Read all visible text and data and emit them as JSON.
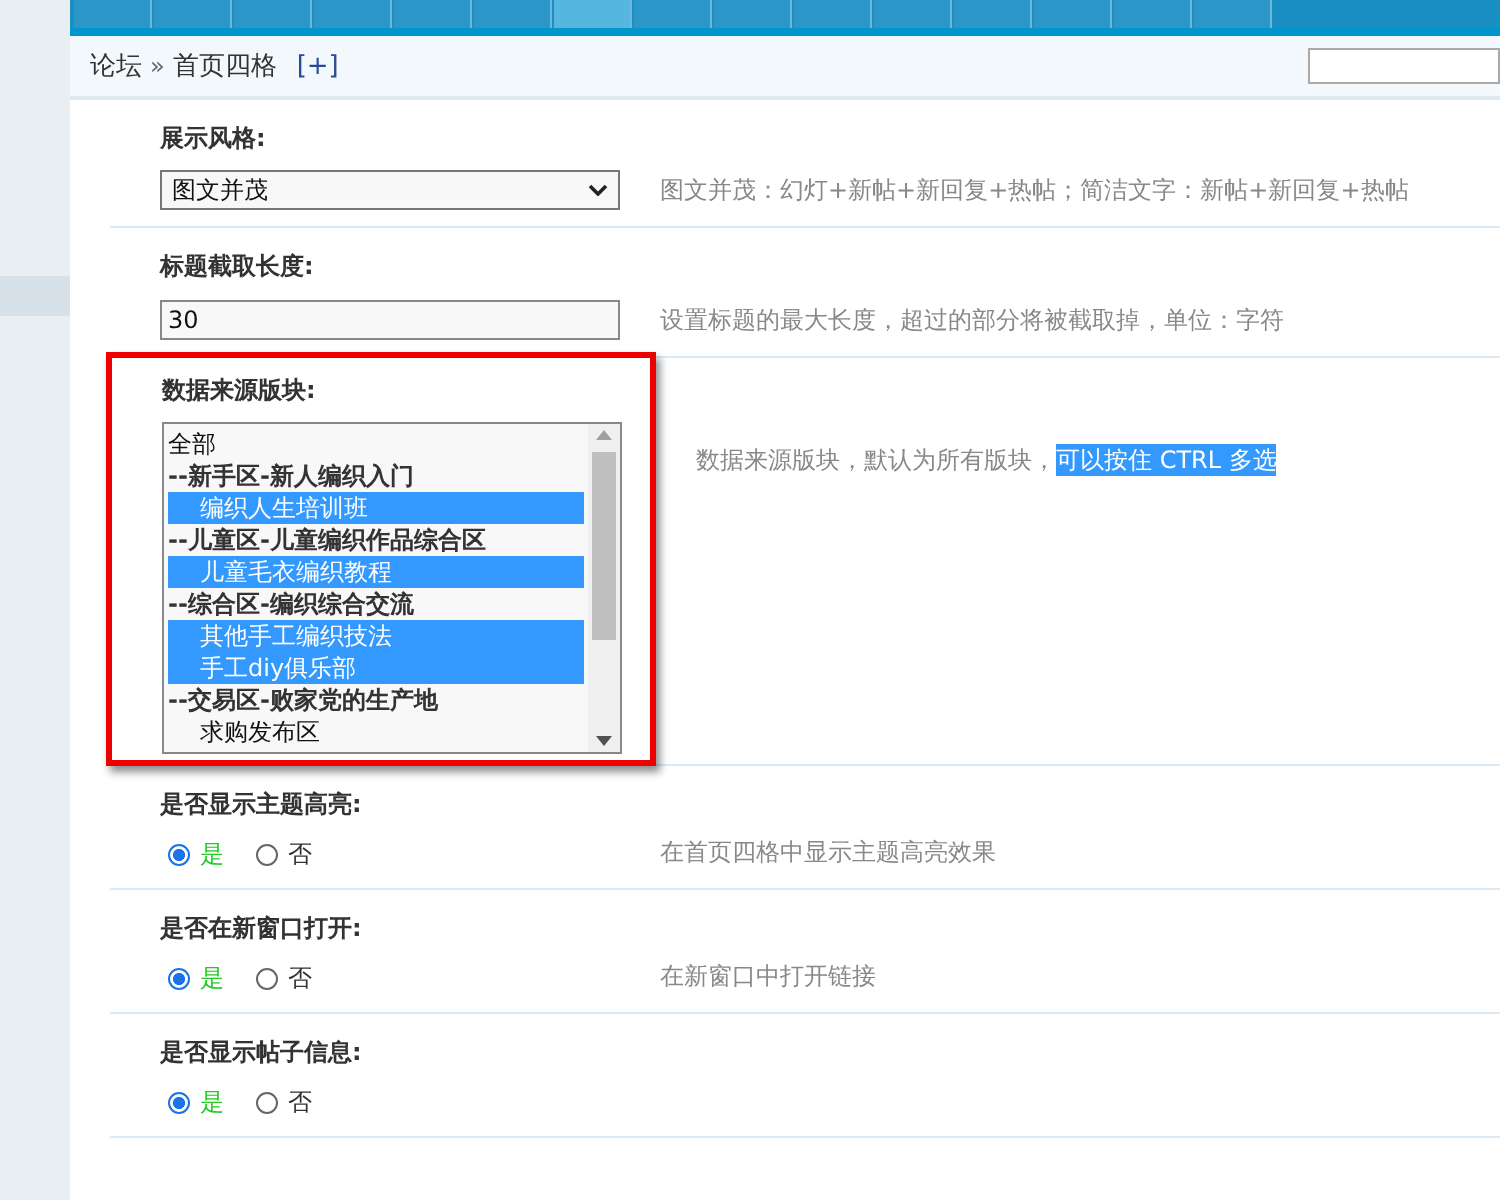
{
  "nav": {
    "tabs": [
      {
        "selected": false
      },
      {
        "selected": false
      },
      {
        "selected": false
      },
      {
        "selected": false
      },
      {
        "selected": false
      },
      {
        "selected": false
      },
      {
        "selected": true
      },
      {
        "selected": false
      },
      {
        "selected": false
      },
      {
        "selected": false
      },
      {
        "selected": false
      },
      {
        "selected": false
      },
      {
        "selected": false
      },
      {
        "selected": false
      },
      {
        "selected": false
      }
    ]
  },
  "breadcrumb": {
    "items": [
      "论坛",
      "首页四格"
    ],
    "separator": "»",
    "add": "[+]"
  },
  "settings": [
    {
      "kind": "select",
      "label": "展示风格:",
      "value": "图文并茂",
      "description": "图文并茂：幻灯+新帖+新回复+热帖；简洁文字：新帖+新回复+热帖",
      "highlighted": false
    },
    {
      "kind": "text",
      "label": "标题截取长度:",
      "value": "30",
      "description": "设置标题的最大长度，超过的部分将被截取掉，单位：字符",
      "highlighted": false
    },
    {
      "kind": "listbox",
      "label": "数据来源版块:",
      "description": "数据来源版块，默认为所有版块，",
      "description_selected": "可以按住 CTRL 多选",
      "highlighted": true,
      "options": [
        {
          "kind": "all",
          "text": "全部",
          "selected": false
        },
        {
          "kind": "category",
          "text": "--新手区-新人编织入门",
          "selected": false
        },
        {
          "kind": "forum",
          "text": "编织人生培训班",
          "selected": true
        },
        {
          "kind": "category",
          "text": "--儿童区-儿童编织作品综合区",
          "selected": false
        },
        {
          "kind": "forum",
          "text": "儿童毛衣编织教程",
          "selected": true
        },
        {
          "kind": "category",
          "text": "--综合区-编织综合交流",
          "selected": false
        },
        {
          "kind": "forum",
          "text": "其他手工编织技法",
          "selected": true
        },
        {
          "kind": "forum",
          "text": "手工diy俱乐部",
          "selected": true
        },
        {
          "kind": "category",
          "text": "--交易区-败家党的生产地",
          "selected": false
        },
        {
          "kind": "forum",
          "text": "求购发布区",
          "selected": false
        }
      ]
    },
    {
      "kind": "radio",
      "label": "是否显示主题高亮:",
      "description": "在首页四格中显示主题高亮效果",
      "highlighted": false,
      "options": [
        {
          "label": "是",
          "selected": true
        },
        {
          "label": "否",
          "selected": false
        }
      ]
    },
    {
      "kind": "radio",
      "label": "是否在新窗口打开:",
      "description": "在新窗口中打开链接",
      "highlighted": false,
      "options": [
        {
          "label": "是",
          "selected": true
        },
        {
          "label": "否",
          "selected": false
        }
      ]
    },
    {
      "kind": "radio",
      "label": "是否显示帖子信息:",
      "highlighted": false,
      "options": [
        {
          "label": "是",
          "selected": true
        },
        {
          "label": "否",
          "selected": false
        }
      ]
    }
  ]
}
